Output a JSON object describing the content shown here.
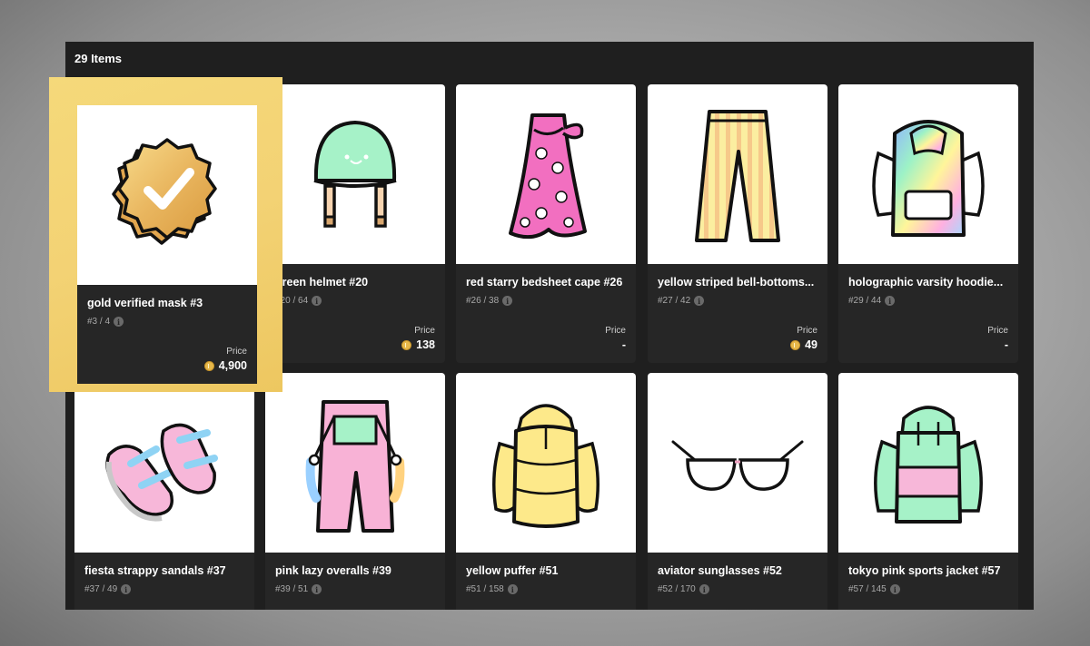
{
  "header": {
    "count_label": "29 Items"
  },
  "price_label": "Price",
  "items": [
    {
      "name": "gold verified mask #3",
      "serial": "#3 / 4",
      "price": "4,900",
      "image": "gold-verified-badge"
    },
    {
      "name": "green helmet #20",
      "serial": "#20 / 64",
      "price": "138",
      "image": "green-helmet"
    },
    {
      "name": "red starry bedsheet cape #26",
      "serial": "#26 / 38",
      "price": "-",
      "image": "bedsheet-cape"
    },
    {
      "name": "yellow striped bell-bottoms...",
      "serial": "#27 / 42",
      "price": "49",
      "image": "striped-pants"
    },
    {
      "name": "holographic varsity hoodie...",
      "serial": "#29 / 44",
      "price": "-",
      "image": "holographic-hoodie"
    },
    {
      "name": "fiesta strappy sandals #37",
      "serial": "#37 / 49",
      "image": "sandals"
    },
    {
      "name": "pink lazy overalls #39",
      "serial": "#39 / 51",
      "image": "overalls"
    },
    {
      "name": "yellow puffer #51",
      "serial": "#51 / 158",
      "image": "puffer-jacket"
    },
    {
      "name": "aviator sunglasses #52",
      "serial": "#52 / 170",
      "image": "sunglasses"
    },
    {
      "name": "tokyo pink sports jacket #57",
      "serial": "#57 / 145",
      "image": "sports-jacket"
    }
  ]
}
